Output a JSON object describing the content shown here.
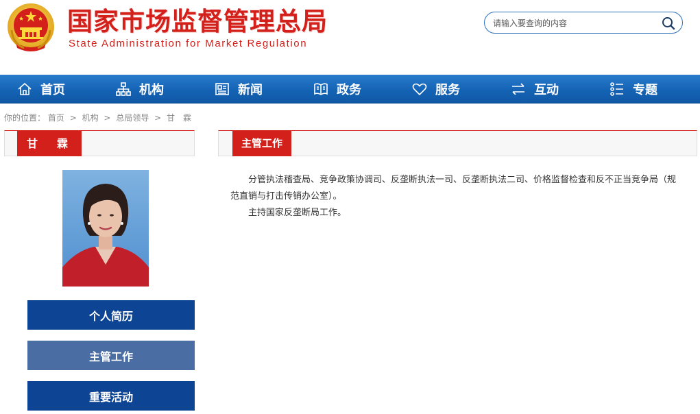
{
  "header": {
    "title_cn": "国家市场监督管理总局",
    "title_en": "State Administration for Market Regulation",
    "search": {
      "placeholder": "请输入要查询的内容"
    }
  },
  "nav": [
    {
      "label": "首页",
      "icon": "home-icon"
    },
    {
      "label": "机构",
      "icon": "org-chart-icon"
    },
    {
      "label": "新闻",
      "icon": "newspaper-icon"
    },
    {
      "label": "政务",
      "icon": "open-book-icon"
    },
    {
      "label": "服务",
      "icon": "heart-icon"
    },
    {
      "label": "互动",
      "icon": "exchange-arrows-icon"
    },
    {
      "label": "专题",
      "icon": "topic-list-icon"
    }
  ],
  "breadcrumb": {
    "prefix": "你的位置：",
    "items": [
      "首页",
      "机构",
      "总局领导",
      "甘　霖"
    ],
    "separator": ">"
  },
  "leader": {
    "name": "甘　霖"
  },
  "side_menu": [
    {
      "label": "个人简历",
      "active": false
    },
    {
      "label": "主管工作",
      "active": true
    },
    {
      "label": "重要活动",
      "active": false
    }
  ],
  "section": {
    "title": "主管工作",
    "paragraphs": [
      "分管执法稽查局、竞争政策协调司、反垄断执法一司、反垄断执法二司、价格监督检查和反不正当竞争局（规范直销与打击传销办公室）。",
      "主持国家反垄断局工作。"
    ]
  },
  "colors": {
    "brand_red": "#d3201b",
    "nav_blue": "#1563b4",
    "menu_dark": "#0e4494",
    "menu_active": "#4a6ea3"
  }
}
